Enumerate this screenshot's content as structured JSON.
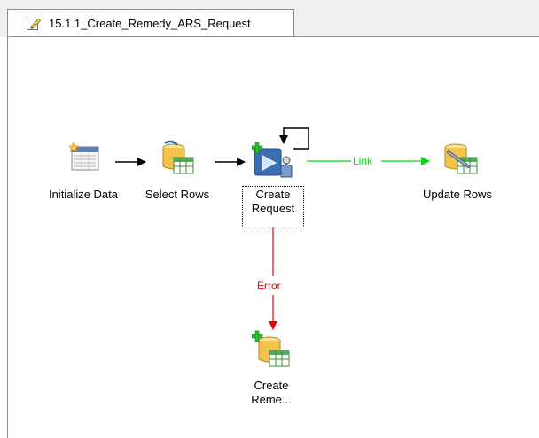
{
  "tab": {
    "icon": "pencil-edit-icon",
    "title": "15.1.1_Create_Remedy_ARS_Request"
  },
  "nodes": {
    "initialize_data": {
      "label": "Initialize Data",
      "icon": "data-grid-icon"
    },
    "select_rows": {
      "label": "Select Rows",
      "icon": "database-table-icon"
    },
    "create_request": {
      "label_line1": "Create",
      "label_line2": "Request",
      "icon": "remedy-create-icon"
    },
    "update_rows": {
      "label": "Update Rows",
      "icon": "database-update-icon"
    },
    "create_reme": {
      "label_line1": "Create",
      "label_line2": "Reme...",
      "icon": "database-create-icon"
    }
  },
  "links": {
    "link_label": "Link",
    "error_label": "Error"
  },
  "colors": {
    "link": "#00dd00",
    "error": "#ee0000",
    "hop": "#000000"
  }
}
